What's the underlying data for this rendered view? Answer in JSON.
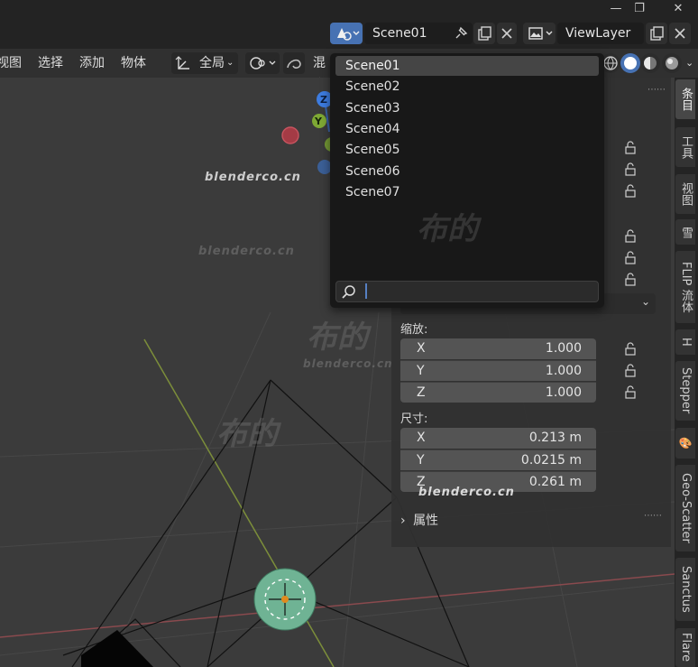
{
  "top_bar": {
    "scene_name": "Scene01",
    "view_layer_name": "ViewLayer",
    "window_minimize": "—",
    "window_maximize": "❐",
    "window_close": "✕"
  },
  "header": {
    "menus": [
      "视图",
      "选择",
      "添加",
      "物体"
    ],
    "transform_orientation": "全局",
    "blend_mode": "混合"
  },
  "scene_dropdown": {
    "items": [
      "Scene01",
      "Scene02",
      "Scene03",
      "Scene04",
      "Scene05",
      "Scene06",
      "Scene07"
    ],
    "active_index": 0,
    "search_value": ""
  },
  "npanel": {
    "scale_label": "缩放:",
    "scale": [
      {
        "axis": "X",
        "value": "1.000"
      },
      {
        "axis": "Y",
        "value": "1.000"
      },
      {
        "axis": "Z",
        "value": "1.000"
      }
    ],
    "dimensions_label": "尺寸:",
    "dimensions": [
      {
        "axis": "X",
        "value": "0.213 m"
      },
      {
        "axis": "Y",
        "value": "0.0215 m"
      },
      {
        "axis": "Z",
        "value": "0.261 m"
      }
    ],
    "properties_label": "属性"
  },
  "side_tabs": [
    {
      "label": "条目",
      "active": true
    },
    {
      "label": "工具",
      "active": false
    },
    {
      "label": "视图",
      "active": false
    },
    {
      "label": "雪",
      "active": false
    },
    {
      "label": "FLIP 流体",
      "active": false
    },
    {
      "label": "H",
      "active": false
    },
    {
      "label": "Stepper",
      "active": false
    },
    {
      "label": "🎨",
      "active": false
    },
    {
      "label": "Geo-Scatter",
      "active": false
    },
    {
      "label": "Sanctus",
      "active": false
    },
    {
      "label": "Flare",
      "active": false
    }
  ],
  "gizmo": {
    "z": "Z",
    "y": "Y"
  },
  "watermarks": {
    "site": "blenderco.cn",
    "brand": "布的"
  },
  "colors": {
    "accent": "#4772b3",
    "background": "#3d3d3d",
    "panel": "#303030"
  }
}
